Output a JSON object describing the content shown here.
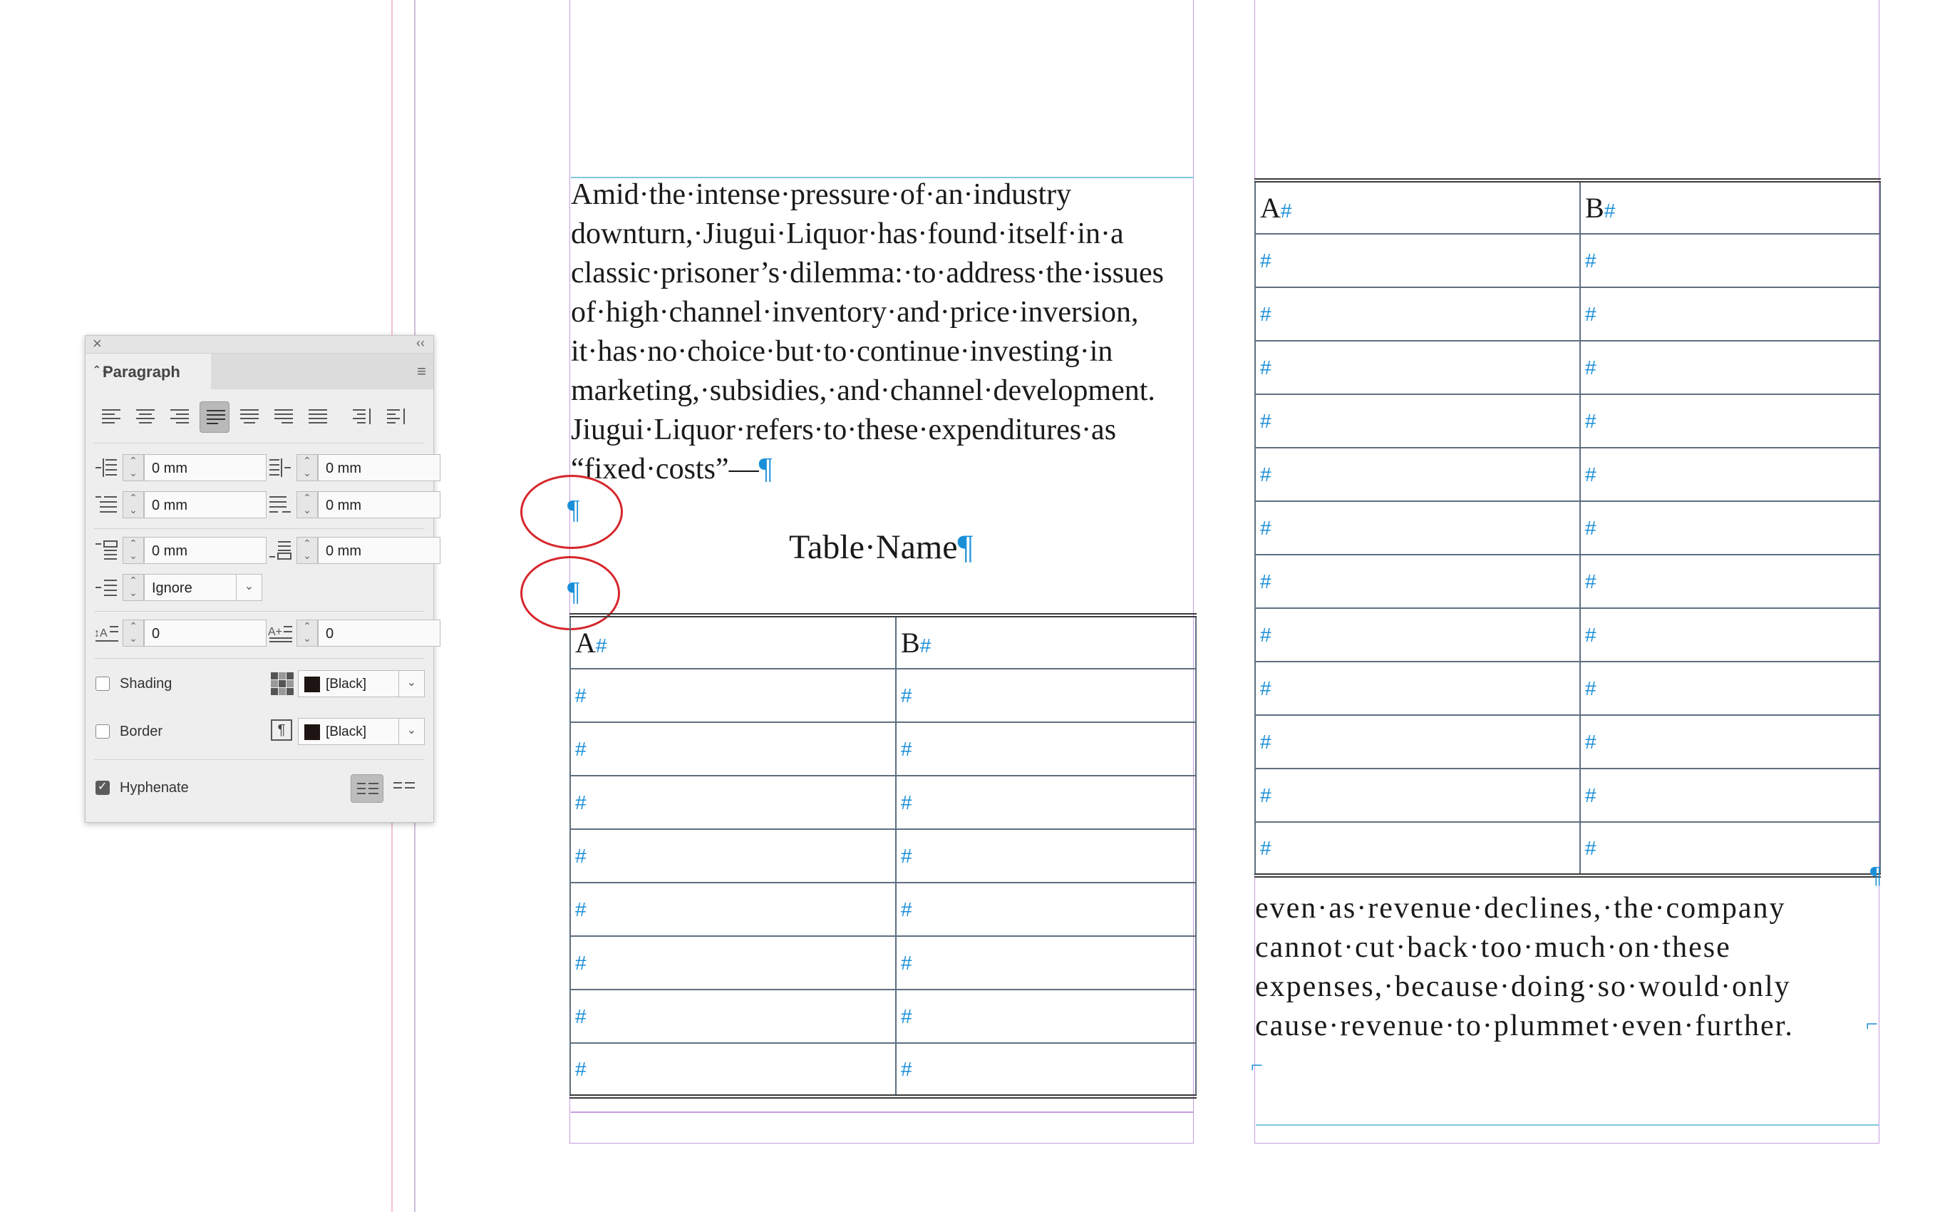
{
  "document": {
    "left_text_lines": [
      "Amid·the·intense·pressure·of·an·industry",
      "downturn,·Jiugui·Liquor·has·found·itself·in·a",
      "classic·prisoner’s·dilemma:·to·address·the·issues",
      "of·high·channel·inventory·and·price·inversion,",
      "it·has·no·choice·but·to·continue·investing·in",
      "marketing,·subsidies,·and·channel·development.",
      "Jiugui·Liquor·refers·to·these·expenditures·as"
    ],
    "left_text_last": "“fixed·costs”—",
    "pilcrow": "¶",
    "table_name": "Table·Name",
    "right_text_lines": [
      "even·as·revenue·declines,·the·company",
      "cannot·cut·back·too·much·on·these",
      "expenses,·because·doing·so·would·only"
    ],
    "right_text_last": "cause·revenue·to·plummet·even·further.",
    "right_end_mark": "⌐",
    "table_left": {
      "headers": [
        "A",
        "B"
      ],
      "hash": "#",
      "body_rows": 8
    },
    "table_right": {
      "headers": [
        "A",
        "B"
      ],
      "hash": "#",
      "body_rows": 12
    }
  },
  "panel": {
    "close_icon": "×",
    "collapse_icon": "‹‹",
    "tab_label": "Paragraph",
    "tab_updown": "⌃⌄",
    "menu_icon": "≡",
    "alignment_active": "left-justify",
    "left_indent": "0 mm",
    "right_indent": "0 mm",
    "first_line_indent": "0 mm",
    "last_line_indent": "0 mm",
    "space_before": "0 mm",
    "space_after": "0 mm",
    "align_to_grid": "Ignore",
    "dropcap_lines": "0",
    "dropcap_chars": "0",
    "shading_label": "Shading",
    "shading_checked": false,
    "shading_color": "[Black]",
    "border_label": "Border",
    "border_checked": false,
    "border_color": "[Black]",
    "hyphenate_label": "Hyphenate",
    "hyphenate_checked": true,
    "swatch_color": "#1e1414"
  }
}
